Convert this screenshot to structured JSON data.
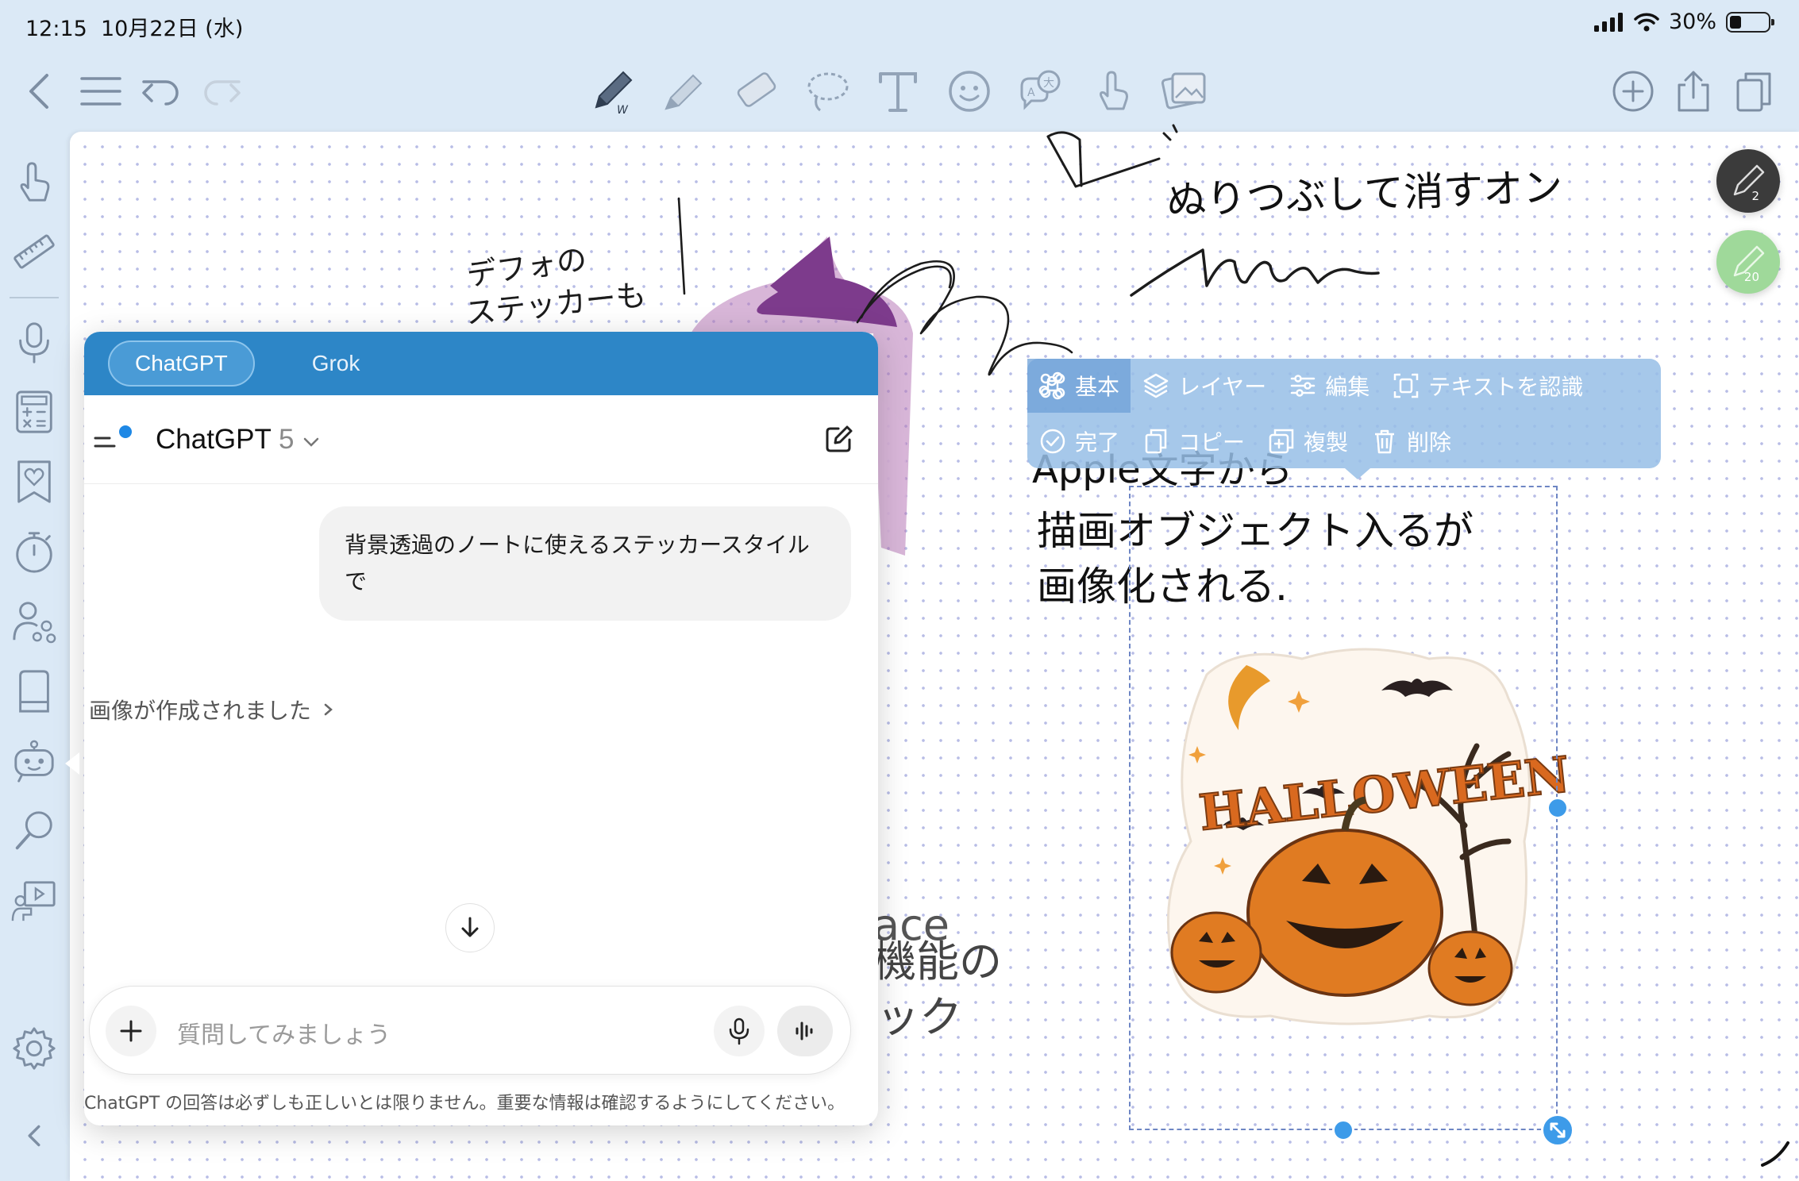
{
  "status_bar": {
    "time": "12:15",
    "date": "10月22日 (水)",
    "battery": "30%",
    "battery_level": 0.3
  },
  "toolbar": {
    "left": [
      "back-icon",
      "list-icon",
      "undo-icon",
      "redo-icon"
    ],
    "tools": [
      "pen-tool-icon",
      "highlighter-icon",
      "eraser-icon",
      "lasso-icon",
      "text-tool-icon",
      "sticker-icon",
      "translate-icon",
      "hand-pointer-icon",
      "image-icon"
    ],
    "right": [
      "add-page-icon",
      "share-icon",
      "pages-icon"
    ]
  },
  "left_rail": [
    "hand-pointer-icon",
    "ruler-icon",
    "microphone-icon",
    "calculator-icon",
    "bookmark-heart-icon",
    "timer-icon",
    "collaboration-icon",
    "document-icon",
    "ai-robot-icon",
    "magnifier-icon",
    "presentation-icon",
    "settings-icon",
    "collapse-icon"
  ],
  "pen_shortcuts": [
    {
      "label": "2",
      "color": "#3b3b3b"
    },
    {
      "label": "20",
      "color": "#9fd99a"
    }
  ],
  "selection_menu": {
    "row1": [
      {
        "icon": "command-icon",
        "label": "基本",
        "active": true
      },
      {
        "icon": "layers-icon",
        "label": "レイヤー",
        "active": false
      },
      {
        "icon": "sliders-icon",
        "label": "編集",
        "active": false
      },
      {
        "icon": "text-recognize-icon",
        "label": "テキストを認識",
        "active": false
      }
    ],
    "row2": [
      {
        "icon": "check-circle-icon",
        "label": "完了"
      },
      {
        "icon": "copy-icon",
        "label": "コピー"
      },
      {
        "icon": "duplicate-icon",
        "label": "複製"
      },
      {
        "icon": "trash-icon",
        "label": "削除"
      }
    ]
  },
  "handwriting": {
    "note1": "デフォの ステッカーも",
    "note2": "ぬりつぶして消すオン",
    "note3": "Apple 文字から 描画オブジェクト入るが 画像化される。",
    "note4": "…ace 機能の …ック"
  },
  "sticker": {
    "text": "HALLOWEEN",
    "colors": {
      "pumpkin": "#e07b22",
      "text": "#d9691f",
      "moon": "#e89a2c",
      "tree": "#3a2a1e"
    }
  },
  "ai_panel": {
    "tabs": [
      {
        "label": "ChatGPT",
        "active": true
      },
      {
        "label": "Grok",
        "active": false
      }
    ],
    "model_name": "ChatGPT",
    "model_version": "5",
    "user_message": "背景透過のノートに使えるステッカースタイルで",
    "image_created": "画像が作成されました",
    "input_placeholder": "質問してみましょう",
    "disclaimer": "ChatGPT の回答は必ずしも正しいとは限りません。重要な情報は確認するようにしてください。"
  },
  "colors": {
    "accent": "#2d86c7",
    "selection": "#3d9be9",
    "app_bg": "#dbe9f6"
  }
}
